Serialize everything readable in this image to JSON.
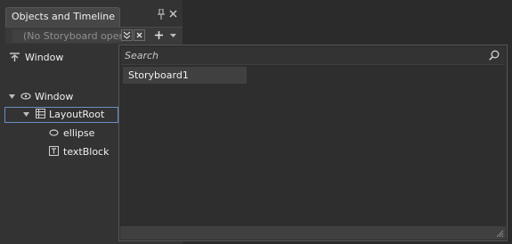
{
  "panel": {
    "title": "Objects and Timeline",
    "storyboard_dropdown": "(No Storyboard open)"
  },
  "window_row": {
    "label": "Window"
  },
  "tree": {
    "items": [
      {
        "label": "Window"
      },
      {
        "label": "LayoutRoot"
      },
      {
        "label": "ellipse"
      },
      {
        "label": "textBlock"
      }
    ]
  },
  "popup": {
    "search_placeholder": "Search",
    "items": [
      {
        "label": "Storyboard1"
      }
    ]
  },
  "colors": {
    "panel_bg": "#333333",
    "selection_border": "#6a8fc4",
    "popup_item_bg": "#404040"
  }
}
